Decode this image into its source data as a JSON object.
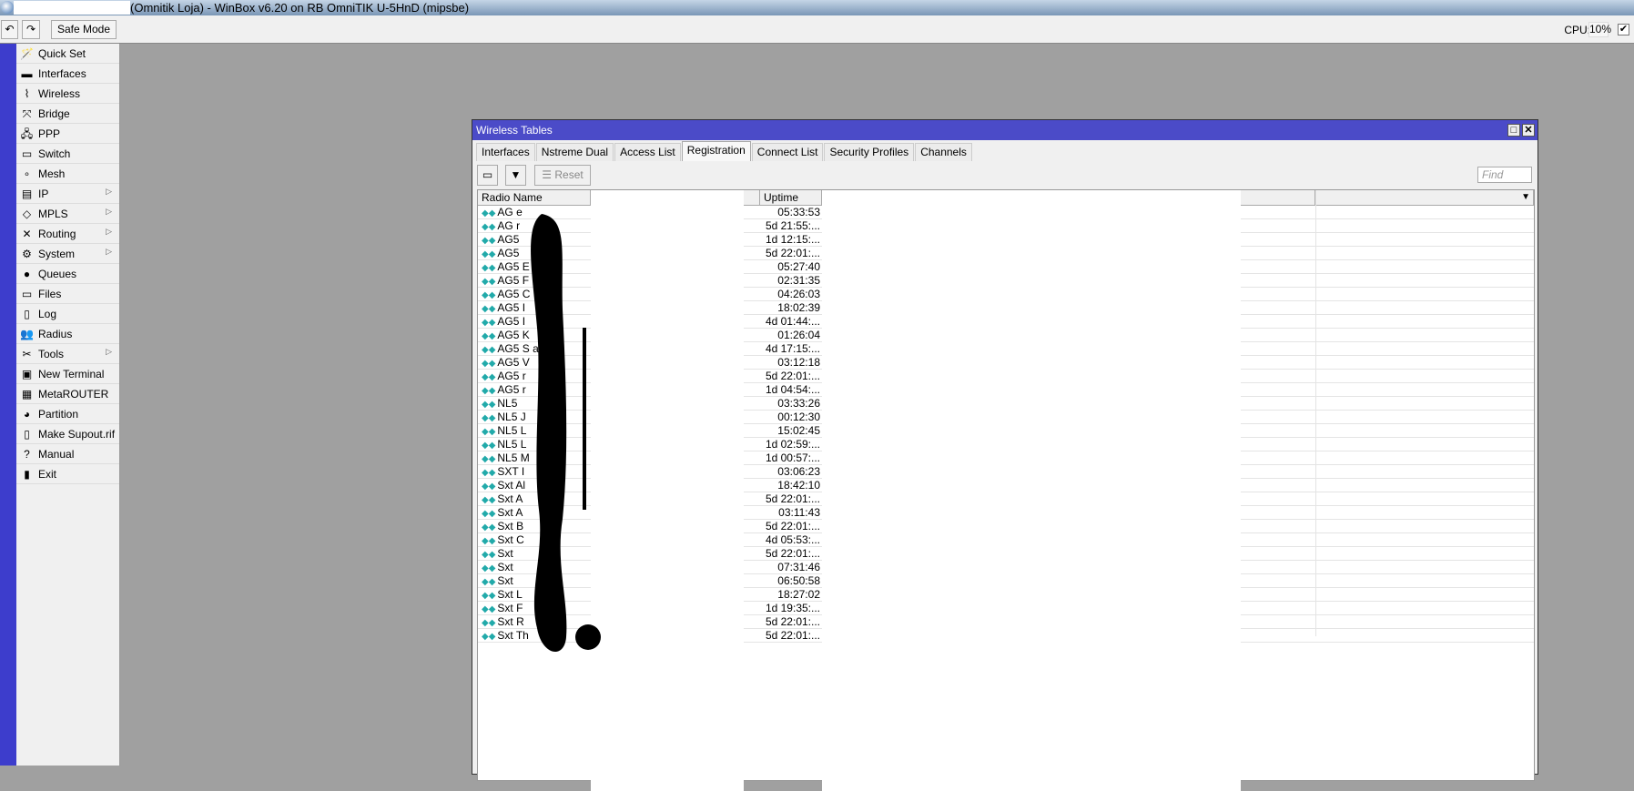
{
  "app": {
    "title": "(Omnitik Loja) - WinBox v6.20 on RB OmniTIK U-5HnD (mipsbe)",
    "undo_icon": "undo-icon",
    "redo_icon": "redo-icon",
    "safe_mode": "Safe Mode",
    "cpu_label": "CPU:",
    "cpu_value": "10%",
    "cpu_checked": true
  },
  "menu": [
    {
      "label": "Quick Set",
      "icon": "🪄"
    },
    {
      "label": "Interfaces",
      "icon": "▬"
    },
    {
      "label": "Wireless",
      "icon": "⌇"
    },
    {
      "label": "Bridge",
      "icon": "⤧"
    },
    {
      "label": "PPP",
      "icon": "🖧"
    },
    {
      "label": "Switch",
      "icon": "▭"
    },
    {
      "label": "Mesh",
      "icon": "∘"
    },
    {
      "label": "IP",
      "icon": "▤",
      "submenu": true
    },
    {
      "label": "MPLS",
      "icon": "◇",
      "submenu": true
    },
    {
      "label": "Routing",
      "icon": "✕",
      "submenu": true
    },
    {
      "label": "System",
      "icon": "⚙",
      "submenu": true
    },
    {
      "label": "Queues",
      "icon": "●"
    },
    {
      "label": "Files",
      "icon": "▭"
    },
    {
      "label": "Log",
      "icon": "▯"
    },
    {
      "label": "Radius",
      "icon": "👥"
    },
    {
      "label": "Tools",
      "icon": "✂",
      "submenu": true
    },
    {
      "label": "New Terminal",
      "icon": "▣"
    },
    {
      "label": "MetaROUTER",
      "icon": "▦"
    },
    {
      "label": "Partition",
      "icon": "◕"
    },
    {
      "label": "Make Supout.rif",
      "icon": "▯"
    },
    {
      "label": "Manual",
      "icon": "?"
    },
    {
      "label": "Exit",
      "icon": "▮"
    }
  ],
  "window": {
    "title": "Wireless Tables",
    "tabs": [
      "Interfaces",
      "Nstreme Dual",
      "Access List",
      "Registration",
      "Connect List",
      "Security Profiles",
      "Channels"
    ],
    "active_tab": "Registration",
    "toolbar": {
      "reset": "Reset",
      "find_placeholder": "Find"
    },
    "columns": {
      "radio_name": "Radio Name",
      "uptime": "Uptime"
    },
    "rows": [
      {
        "name": "AG e",
        "uptime": "05:33:53"
      },
      {
        "name": "AG r",
        "uptime": "5d 21:55:..."
      },
      {
        "name": "AG5",
        "uptime": "1d 12:15:..."
      },
      {
        "name": "AG5",
        "uptime": "5d 22:01:..."
      },
      {
        "name": "AG5 E",
        "uptime": "05:27:40"
      },
      {
        "name": "AG5 F",
        "uptime": "02:31:35"
      },
      {
        "name": "AG5 C",
        "uptime": "04:26:03"
      },
      {
        "name": "AG5 I",
        "uptime": "18:02:39"
      },
      {
        "name": "AG5 I",
        "uptime": "4d 01:44:..."
      },
      {
        "name": "AG5 K",
        "uptime": "01:26:04"
      },
      {
        "name": "AG5 S          a",
        "uptime": "4d 17:15:..."
      },
      {
        "name": "AG5 V",
        "uptime": "03:12:18"
      },
      {
        "name": "AG5 r",
        "uptime": "5d 22:01:..."
      },
      {
        "name": "AG5 r",
        "uptime": "1d 04:54:..."
      },
      {
        "name": "NL5",
        "uptime": "03:33:26"
      },
      {
        "name": "NL5 J",
        "uptime": "00:12:30"
      },
      {
        "name": "NL5 L",
        "uptime": "15:02:45"
      },
      {
        "name": "NL5 L",
        "uptime": "1d 02:59:..."
      },
      {
        "name": "NL5 M",
        "uptime": "1d 00:57:..."
      },
      {
        "name": "SXT I",
        "uptime": "03:06:23"
      },
      {
        "name": "Sxt Al",
        "uptime": "18:42:10"
      },
      {
        "name": "Sxt A",
        "uptime": "5d 22:01:..."
      },
      {
        "name": "Sxt A",
        "uptime": "03:11:43"
      },
      {
        "name": "Sxt B",
        "uptime": "5d 22:01:..."
      },
      {
        "name": "Sxt C",
        "uptime": "4d 05:53:..."
      },
      {
        "name": "Sxt",
        "uptime": "5d 22:01:..."
      },
      {
        "name": "Sxt",
        "uptime": "07:31:46"
      },
      {
        "name": "Sxt",
        "uptime": "06:50:58"
      },
      {
        "name": "Sxt L",
        "uptime": "18:27:02"
      },
      {
        "name": "Sxt F",
        "uptime": "1d 19:35:..."
      },
      {
        "name": "Sxt R",
        "uptime": "5d 22:01:..."
      },
      {
        "name": "Sxt Th",
        "uptime": "5d 22:01:..."
      }
    ]
  }
}
